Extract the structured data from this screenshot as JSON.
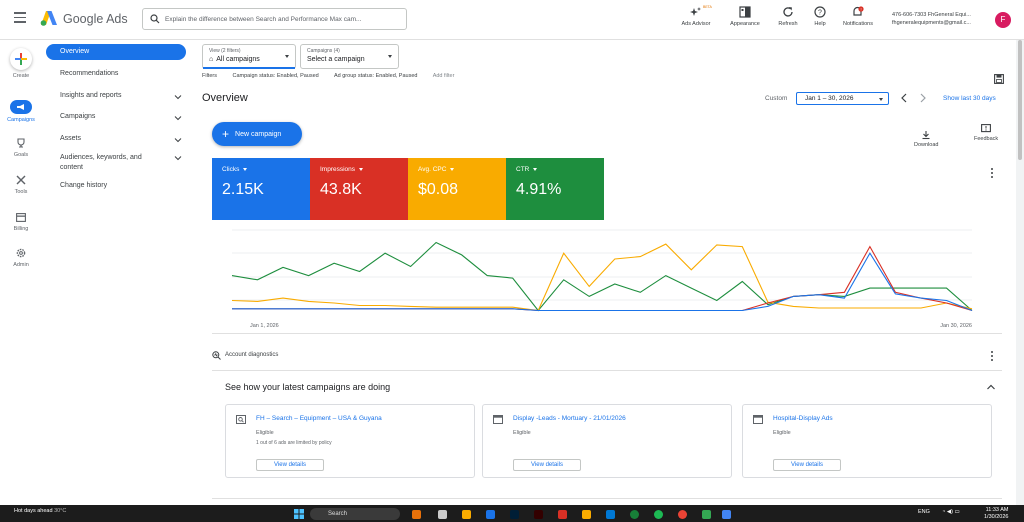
{
  "header": {
    "brand": "Google Ads",
    "search_placeholder": "Explain the difference between Search and Performance Max cam...",
    "tools": [
      {
        "name": "ads-advisor",
        "label": "Ads Advisor",
        "badge": "BETA",
        "icon": "sparkle-icon"
      },
      {
        "name": "appearance",
        "label": "Appearance",
        "icon": "appearance-icon"
      },
      {
        "name": "refresh",
        "label": "Refresh",
        "icon": "refresh-icon"
      },
      {
        "name": "help",
        "label": "Help",
        "icon": "help-icon"
      },
      {
        "name": "notifications",
        "label": "Notifications",
        "icon": "bell-icon",
        "badge": "!"
      }
    ],
    "account_line1": "476-606-7303 FhGeneral Equi...",
    "account_line2": "fhgeneralequipments@gmail.c...",
    "avatar_letter": "F",
    "avatar_color": "#d81b60"
  },
  "rail": [
    {
      "name": "create",
      "label": "Create",
      "icon": "plus-icon"
    },
    {
      "name": "campaigns",
      "label": "Campaigns",
      "icon": "megaphone-icon",
      "active": true
    },
    {
      "name": "goals",
      "label": "Goals",
      "icon": "trophy-icon"
    },
    {
      "name": "tools",
      "label": "Tools",
      "icon": "wrench-icon"
    },
    {
      "name": "billing",
      "label": "Billing",
      "icon": "billing-icon"
    },
    {
      "name": "admin",
      "label": "Admin",
      "icon": "gear-icon"
    }
  ],
  "subnav": {
    "overview": "Overview",
    "recommendations": "Recommendations",
    "insights": "Insights and reports",
    "campaigns": "Campaigns",
    "assets": "Assets",
    "audiences_l1": "Audiences, keywords, and",
    "audiences_l2": "content",
    "change_history": "Change history"
  },
  "selectors": {
    "view_label": "View (2 filters)",
    "view_value": "All campaigns",
    "campaigns_label": "Campaigns (4)",
    "campaigns_value": "Select a campaign"
  },
  "filters": {
    "label": "Filters",
    "campaign_status": "Campaign status: Enabled, Paused",
    "ad_group_status": "Ad group status: Enabled, Paused",
    "add": "Add filter"
  },
  "overview": {
    "title": "Overview",
    "custom": "Custom",
    "date_range": "Jan 1 – 30, 2026",
    "show_last": "Show last 30 days",
    "new_campaign": "New campaign",
    "download": "Download",
    "feedback": "Feedback"
  },
  "metrics": [
    {
      "name": "Clicks",
      "value": "2.15K",
      "color": "#1a73e8"
    },
    {
      "name": "Impressions",
      "value": "43.8K",
      "color": "#d93025"
    },
    {
      "name": "Avg. CPC",
      "value": "$0.08",
      "color": "#f9ab00"
    },
    {
      "name": "CTR",
      "value": "4.91%",
      "color": "#1e8e3e"
    }
  ],
  "chart_data": {
    "type": "line",
    "x_start_label": "Jan 1, 2026",
    "x_end_label": "Jan 30, 2026",
    "x": [
      1,
      2,
      3,
      4,
      5,
      6,
      7,
      8,
      9,
      10,
      11,
      12,
      13,
      14,
      15,
      16,
      17,
      18,
      19,
      20,
      21,
      22,
      23,
      24,
      25,
      26,
      27,
      28,
      29,
      30
    ],
    "grid": true,
    "series": [
      {
        "metric": "Clicks",
        "color": "#1a73e8",
        "values": [
          5,
          5,
          5,
          5,
          5,
          5,
          5,
          5,
          5,
          5,
          5,
          5,
          3,
          3,
          3,
          3,
          3,
          3,
          3,
          3,
          3,
          8,
          20,
          22,
          18,
          72,
          23,
          18,
          15,
          3
        ]
      },
      {
        "metric": "Impressions",
        "color": "#d93025",
        "values": [
          5,
          5,
          5,
          5,
          5,
          5,
          5,
          5,
          5,
          5,
          5,
          5,
          3,
          3,
          3,
          3,
          3,
          3,
          3,
          3,
          3,
          12,
          20,
          22,
          25,
          80,
          25,
          18,
          12,
          3
        ]
      },
      {
        "metric": "Avg. CPC",
        "color": "#f9ab00",
        "values": [
          15,
          14,
          18,
          14,
          12,
          9,
          9,
          8,
          7,
          7,
          7,
          7,
          3,
          72,
          32,
          65,
          68,
          83,
          52,
          82,
          80,
          13,
          8,
          6,
          6,
          6,
          6,
          6,
          12,
          5
        ]
      },
      {
        "metric": "CTR",
        "color": "#1e8e3e",
        "values": [
          45,
          40,
          55,
          45,
          60,
          50,
          72,
          56,
          85,
          70,
          45,
          42,
          3,
          40,
          20,
          35,
          25,
          45,
          30,
          15,
          38,
          10,
          20,
          22,
          20,
          30,
          30,
          30,
          30,
          3
        ]
      }
    ]
  },
  "diagnostics": {
    "title": "Account diagnostics",
    "heading": "See how your latest campaigns are doing"
  },
  "cards": [
    {
      "title": "FH – Search – Equipment – USA & Guyana",
      "status": "Eligible",
      "note": "1 out of 6 ads are limited by policy",
      "button": "View details",
      "icon": "search-campaign-icon"
    },
    {
      "title": "Display -Leads - Mortuary - 21/01/2026",
      "status": "Eligible",
      "note": "",
      "button": "View details",
      "icon": "display-campaign-icon"
    },
    {
      "title": "Hospital-Display Ads",
      "status": "Eligible",
      "note": "",
      "button": "View details",
      "icon": "display-campaign-icon"
    }
  ],
  "taskbar": {
    "weather_l1": "Hot days ahead",
    "weather_l2": "30°C",
    "search": "Search",
    "lang": "ENG",
    "time": "11:33 AM",
    "date": "1/30/2026"
  }
}
